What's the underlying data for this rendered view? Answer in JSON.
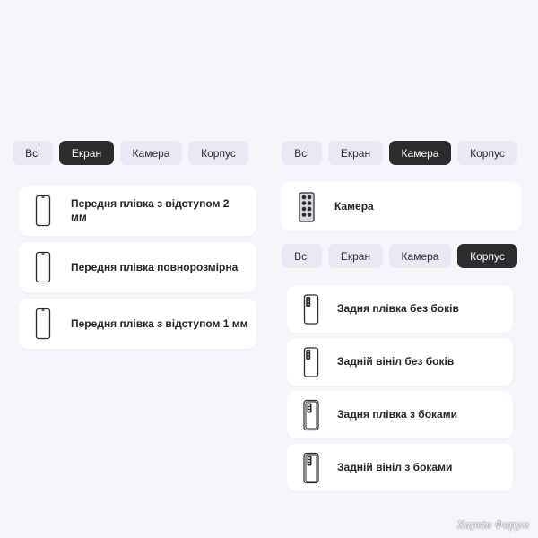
{
  "left_panel": {
    "tabs": [
      {
        "label": "Всі",
        "active": false
      },
      {
        "label": "Екран",
        "active": true
      },
      {
        "label": "Камера",
        "active": false
      },
      {
        "label": "Корпус",
        "active": false
      }
    ],
    "items": [
      {
        "label": "Передня плівка з відступом 2 мм",
        "icon": "phone-front-icon"
      },
      {
        "label": "Передня плівка повнорозмірна",
        "icon": "phone-front-icon"
      },
      {
        "label": "Передня плівка з відступом 1 мм",
        "icon": "phone-front-icon"
      }
    ]
  },
  "right_panel": {
    "tabs": [
      {
        "label": "Всі",
        "active": false
      },
      {
        "label": "Екран",
        "active": false
      },
      {
        "label": "Камера",
        "active": true
      },
      {
        "label": "Корпус",
        "active": false
      }
    ],
    "camera_item": {
      "label": "Камера",
      "icon": "camera-module-icon"
    },
    "tabs2": [
      {
        "label": "Всі",
        "active": false
      },
      {
        "label": "Екран",
        "active": false
      },
      {
        "label": "Камера",
        "active": false
      },
      {
        "label": "Корпус",
        "active": true
      }
    ],
    "items": [
      {
        "label": "Задня плівка без боків",
        "icon": "phone-back-icon"
      },
      {
        "label": "Задній вініл без боків",
        "icon": "phone-back-icon"
      },
      {
        "label": "Задня плівка з боками",
        "icon": "phone-back-sides-icon"
      },
      {
        "label": "Задній вініл з боками",
        "icon": "phone-back-sides-icon"
      }
    ]
  },
  "watermark": "Харків Форум",
  "colors": {
    "background": "#f6f5fa",
    "tab_inactive": "#ebe8f6",
    "tab_active": "#2c2c2f",
    "card": "#ffffff"
  }
}
